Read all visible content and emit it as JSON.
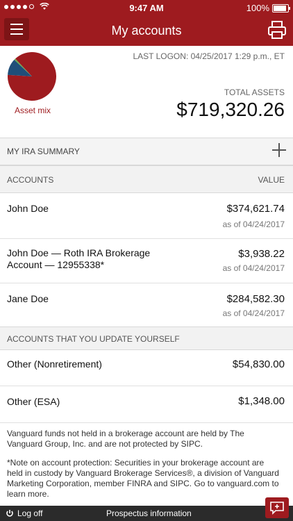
{
  "status_bar": {
    "time": "9:47 AM",
    "battery": "100%",
    "battery_level": 1.0,
    "signal_bars": 4
  },
  "header": {
    "title": "My accounts"
  },
  "summary": {
    "asset_mix_label": "Asset mix",
    "asset_mix_slices": [
      {
        "fraction": 0.88,
        "color": "#9e1b1f"
      },
      {
        "fraction": 0.11,
        "color": "#1f4e79"
      },
      {
        "fraction": 0.01,
        "color": "#6aa84f"
      }
    ],
    "last_logon": "LAST LOGON: 04/25/2017 1:29 p.m., ET",
    "total_label": "TOTAL ASSETS",
    "total_value": "$719,320.26"
  },
  "ira_summary": {
    "label": "MY IRA SUMMARY"
  },
  "accounts_header": {
    "accounts_label": "ACCOUNTS",
    "value_label": "VALUE"
  },
  "accounts": [
    {
      "name": "John Doe",
      "value": "$374,621.74",
      "as_of": "as of 04/24/2017"
    },
    {
      "name": "John Doe — Roth IRA Brokerage Account — 12955338*",
      "value": "$3,938.22",
      "as_of": "as of 04/24/2017"
    },
    {
      "name": "Jane Doe",
      "value": "$284,582.30",
      "as_of": "as of 04/24/2017"
    }
  ],
  "self_update_header": {
    "label": "ACCOUNTS THAT YOU UPDATE YOURSELF"
  },
  "self_accounts": [
    {
      "name": "Other (Nonretirement)",
      "value": "$54,830.00"
    },
    {
      "name": "Other (ESA)",
      "value": "$1,348.00"
    }
  ],
  "footnotes": {
    "note1": "Vanguard funds not held in a brokerage account are held by The Vanguard Group, Inc. and are not protected by SIPC.",
    "note2": "*Note on account protection: Securities in your brokerage account are held in custody by Vanguard Brokerage Services®, a division of Vanguard Marketing Corporation, member FINRA and SIPC. Go to vanguard.com to learn more."
  },
  "bottom_bar": {
    "logoff_label": "Log off",
    "prospectus_label": "Prospectus information"
  },
  "icons": [
    "menu-icon",
    "print-icon",
    "plus-icon",
    "logoff-icon",
    "chat-icon",
    "wifi-icon",
    "battery-icon"
  ]
}
